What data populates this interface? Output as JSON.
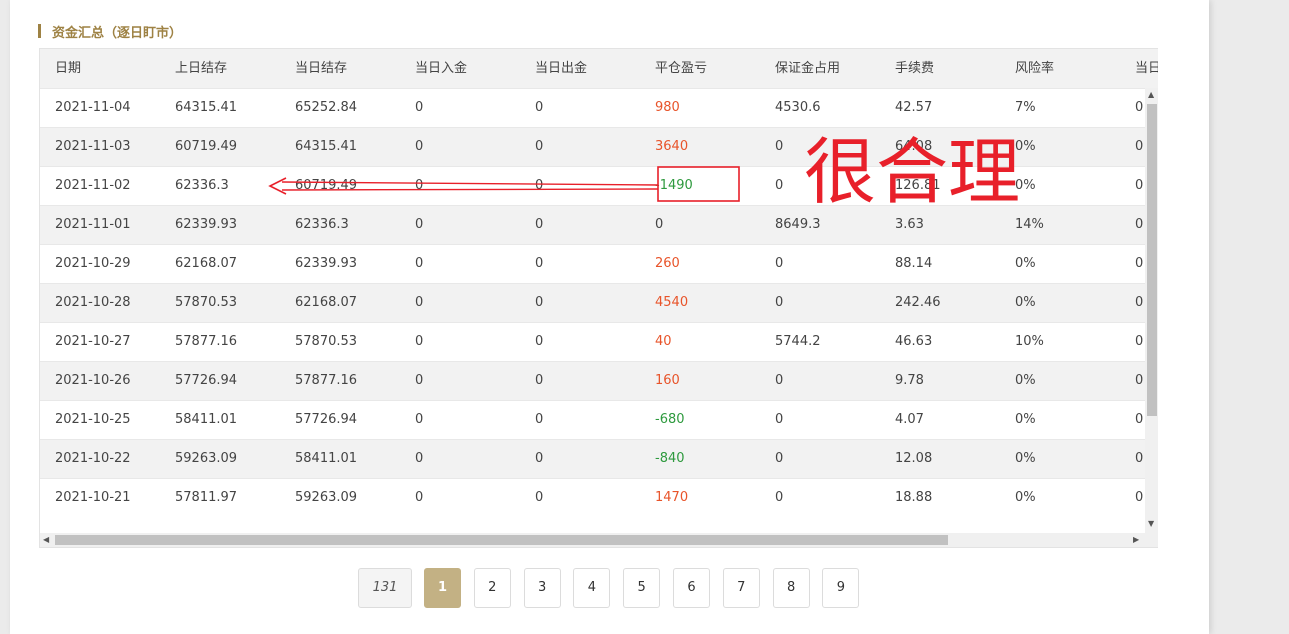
{
  "section": {
    "title": "资金汇总（逐日盯市）"
  },
  "table": {
    "columns": [
      "日期",
      "上日结存",
      "当日结存",
      "当日入金",
      "当日出金",
      "平仓盈亏",
      "保证金占用",
      "手续费",
      "风险率",
      "当日"
    ],
    "rows": [
      {
        "date": "2021-11-04",
        "prev": "64315.41",
        "curr": "65252.84",
        "in": "0",
        "out": "0",
        "pnl": "980",
        "margin": "4530.6",
        "fee": "42.57",
        "risk": "7%",
        "extra": "0"
      },
      {
        "date": "2021-11-03",
        "prev": "60719.49",
        "curr": "64315.41",
        "in": "0",
        "out": "0",
        "pnl": "3640",
        "margin": "0",
        "fee": "64.08",
        "risk": "0%",
        "extra": "0"
      },
      {
        "date": "2021-11-02",
        "prev": "62336.3",
        "curr": "60719.49",
        "in": "0",
        "out": "0",
        "pnl": "-1490",
        "margin": "0",
        "fee": "126.81",
        "risk": "0%",
        "extra": "0"
      },
      {
        "date": "2021-11-01",
        "prev": "62339.93",
        "curr": "62336.3",
        "in": "0",
        "out": "0",
        "pnl": "0",
        "margin": "8649.3",
        "fee": "3.63",
        "risk": "14%",
        "extra": "0"
      },
      {
        "date": "2021-10-29",
        "prev": "62168.07",
        "curr": "62339.93",
        "in": "0",
        "out": "0",
        "pnl": "260",
        "margin": "0",
        "fee": "88.14",
        "risk": "0%",
        "extra": "0"
      },
      {
        "date": "2021-10-28",
        "prev": "57870.53",
        "curr": "62168.07",
        "in": "0",
        "out": "0",
        "pnl": "4540",
        "margin": "0",
        "fee": "242.46",
        "risk": "0%",
        "extra": "0"
      },
      {
        "date": "2021-10-27",
        "prev": "57877.16",
        "curr": "57870.53",
        "in": "0",
        "out": "0",
        "pnl": "40",
        "margin": "5744.2",
        "fee": "46.63",
        "risk": "10%",
        "extra": "0"
      },
      {
        "date": "2021-10-26",
        "prev": "57726.94",
        "curr": "57877.16",
        "in": "0",
        "out": "0",
        "pnl": "160",
        "margin": "0",
        "fee": "9.78",
        "risk": "0%",
        "extra": "0"
      },
      {
        "date": "2021-10-25",
        "prev": "58411.01",
        "curr": "57726.94",
        "in": "0",
        "out": "0",
        "pnl": "-680",
        "margin": "0",
        "fee": "4.07",
        "risk": "0%",
        "extra": "0"
      },
      {
        "date": "2021-10-22",
        "prev": "59263.09",
        "curr": "58411.01",
        "in": "0",
        "out": "0",
        "pnl": "-840",
        "margin": "0",
        "fee": "12.08",
        "risk": "0%",
        "extra": "0"
      },
      {
        "date": "2021-10-21",
        "prev": "57811.97",
        "curr": "59263.09",
        "in": "0",
        "out": "0",
        "pnl": "1470",
        "margin": "0",
        "fee": "18.88",
        "risk": "0%",
        "extra": "0"
      }
    ]
  },
  "annotation": {
    "text": "很合理"
  },
  "pagination": {
    "total": "131",
    "pages": [
      "1",
      "2",
      "3",
      "4",
      "5",
      "6",
      "7",
      "8",
      "9"
    ],
    "active": "1"
  },
  "colors": {
    "accent": "#9e8244",
    "active_page": "#c3b184",
    "positive": "#e8542a",
    "negative": "#2e9a3e",
    "annotation": "#e8202a"
  },
  "icons": {
    "scroll_up": "triangle-up-icon",
    "scroll_down": "triangle-down-icon",
    "scroll_left": "triangle-left-icon",
    "scroll_right": "triangle-right-icon"
  }
}
